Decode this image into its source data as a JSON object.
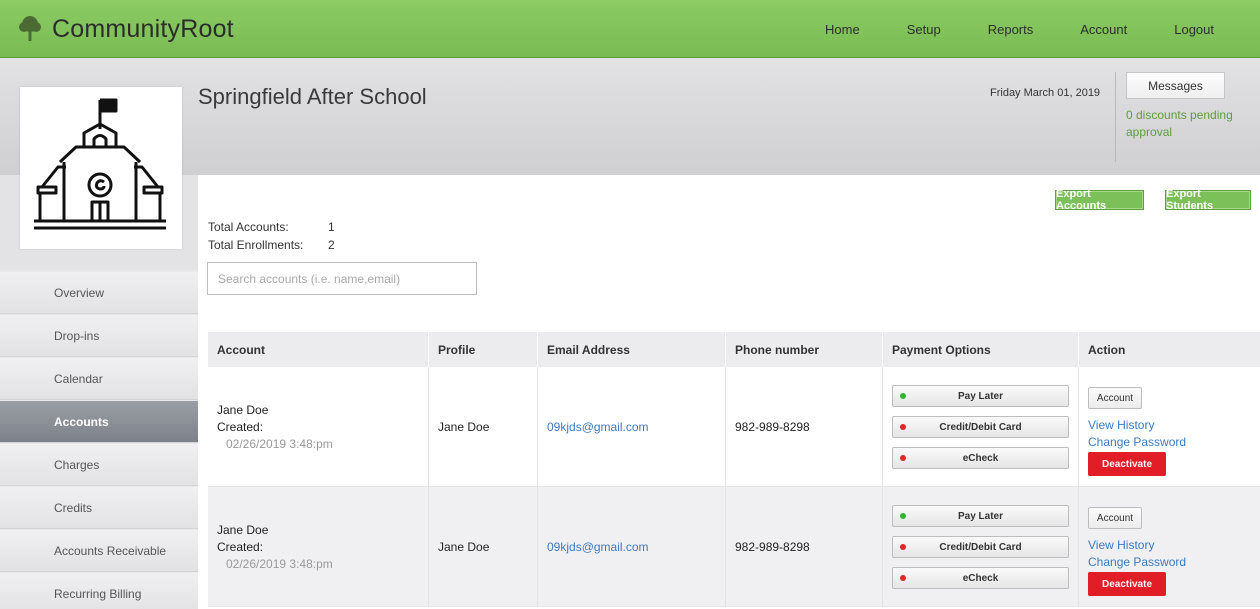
{
  "app": {
    "name": "CommunityRoot",
    "logo_icon": "tree-icon"
  },
  "nav": [
    "Home",
    "Setup",
    "Reports",
    "Account",
    "Logout"
  ],
  "header": {
    "org_name": "Springfield After School",
    "date": "Friday March 01, 2019",
    "messages_label": "Messages",
    "pending_text": "0 discounts pending approval"
  },
  "sidebar": [
    {
      "label": "Overview"
    },
    {
      "label": "Drop-ins"
    },
    {
      "label": "Calendar"
    },
    {
      "label": "Accounts",
      "active": true
    },
    {
      "label": "Charges"
    },
    {
      "label": "Credits"
    },
    {
      "label": "Accounts Receivable"
    },
    {
      "label": "Recurring Billing"
    }
  ],
  "toolbar": {
    "export_accounts": "Export Accounts",
    "export_students": "Export Students"
  },
  "stats": {
    "total_accounts_label": "Total Accounts:",
    "total_accounts": "1",
    "total_enrollments_label": "Total Enrollments:",
    "total_enrollments": "2"
  },
  "search": {
    "placeholder": "Search accounts (i.e. name,email)"
  },
  "table": {
    "headers": [
      "Account",
      "Profile",
      "Email Address",
      "Phone number",
      "Payment Options",
      "Action"
    ],
    "rows": [
      {
        "account_name": "Jane Doe",
        "created_label": "Created:",
        "created_date": "02/26/2019 3:48:pm",
        "profile": "Jane Doe",
        "email": "09kjds@gmail.com",
        "phone": "982-989-8298",
        "payment": [
          "Pay Later",
          "Credit/Debit Card",
          "eCheck"
        ],
        "actions": {
          "account": "Account",
          "history": "View History",
          "password": "Change Password",
          "deactivate": "Deactivate"
        }
      },
      {
        "account_name": "Jane Doe",
        "created_label": "Created:",
        "created_date": "02/26/2019 3:48:pm",
        "profile": "Jane Doe",
        "email": "09kjds@gmail.com",
        "phone": "982-989-8298",
        "payment": [
          "Pay Later",
          "Credit/Debit Card",
          "eCheck"
        ],
        "actions": {
          "account": "Account",
          "history": "View History",
          "password": "Change Password",
          "deactivate": "Deactivate"
        }
      }
    ]
  },
  "colors": {
    "brand_green": "#7cc05a",
    "danger": "#e21d28",
    "link": "#3a7cc2",
    "status_on": "#2fb52f",
    "status_off": "#e02727"
  }
}
